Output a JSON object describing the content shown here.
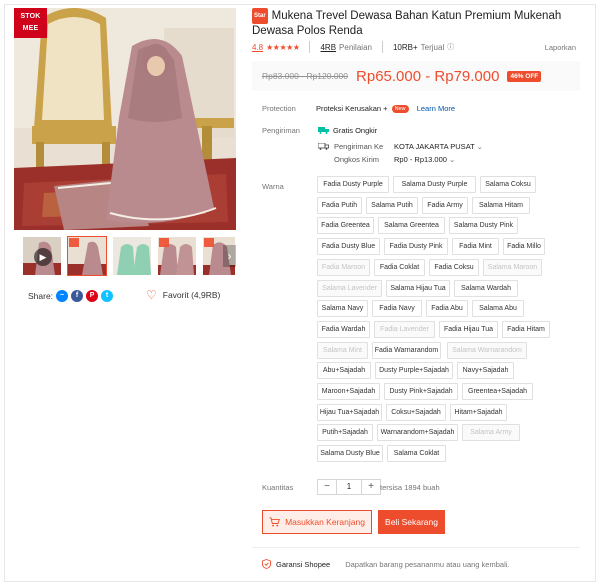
{
  "gallery": {
    "badge_line1": "STOK",
    "badge_line2": "MEE"
  },
  "share": {
    "label": "Share:",
    "icons": [
      "messenger-icon",
      "facebook-icon",
      "pinterest-icon",
      "twitter-icon"
    ]
  },
  "favorite": {
    "label": "Favorit (4,9RB)"
  },
  "product": {
    "star_badge": "Star",
    "title": "Mukena Trevel Dewasa Bahan Katun Premium Mukenah Dewasa Polos Renda",
    "rating": "4.8",
    "stars": "★★★★★",
    "review_count": "4RB",
    "review_label": "Penilaian",
    "sold_count": "10RB+",
    "sold_label": "Terjual",
    "report": "Laporkan",
    "old_price": "Rp83.000 - Rp120.000",
    "price": "Rp65.000 - Rp79.000",
    "discount": "46% OFF"
  },
  "protection": {
    "label": "Protection",
    "value": "Proteksi Kerusakan +",
    "badge": "New",
    "link": "Learn More"
  },
  "shipping": {
    "label": "Pengiriman",
    "free": "Gratis Ongkir",
    "to_label": "Pengiriman Ke",
    "to_value": "KOTA JAKARTA PUSAT",
    "cost_label": "Ongkos Kirim",
    "cost_value": "Rp0 - Rp13.000"
  },
  "variants": {
    "label": "Warna",
    "items": [
      {
        "label": "Fadia Dusty Purple",
        "disabled": false
      },
      {
        "label": "Salama Dusty Purple",
        "disabled": false
      },
      {
        "label": "Salama Coksu",
        "disabled": false
      },
      {
        "label": "Fadia Putih",
        "disabled": false
      },
      {
        "label": "Salama Putih",
        "disabled": false
      },
      {
        "label": "Fadia Army",
        "disabled": false
      },
      {
        "label": "Salama Hitam",
        "disabled": false
      },
      {
        "label": "Fadia Greentea",
        "disabled": false
      },
      {
        "label": "Salama Greentea",
        "disabled": false
      },
      {
        "label": "Salama Dusty Pink",
        "disabled": false
      },
      {
        "label": "Fadia Dusty Blue",
        "disabled": false
      },
      {
        "label": "Fadia Dusty Pink",
        "disabled": false
      },
      {
        "label": "Fadia Mint",
        "disabled": false
      },
      {
        "label": "Fadia Millo",
        "disabled": false
      },
      {
        "label": "Fadia Maroon",
        "disabled": true
      },
      {
        "label": "Fadia Coklat",
        "disabled": false
      },
      {
        "label": "Fadia Coksu",
        "disabled": false
      },
      {
        "label": "Salama Maroon",
        "disabled": true
      },
      {
        "label": "Salama Lavender",
        "disabled": true
      },
      {
        "label": "Salama Hijau Tua",
        "disabled": false
      },
      {
        "label": "Salama Wardah",
        "disabled": false
      },
      {
        "label": "Salama Navy",
        "disabled": false
      },
      {
        "label": "Fadia Navy",
        "disabled": false
      },
      {
        "label": "Fadia Abu",
        "disabled": false
      },
      {
        "label": "Salama Abu",
        "disabled": false
      },
      {
        "label": "Fadia Wardah",
        "disabled": false
      },
      {
        "label": "Fadia Lavender",
        "disabled": true
      },
      {
        "label": "Fadia Hijau Tua",
        "disabled": false
      },
      {
        "label": "Fadia Hitam",
        "disabled": false
      },
      {
        "label": "Salama Mint",
        "disabled": true
      },
      {
        "label": "Fadia Warnarandom",
        "disabled": false
      },
      {
        "label": "Salama Warnarandom",
        "disabled": true
      },
      {
        "label": "Abu+Sajadah",
        "disabled": false
      },
      {
        "label": "Dusty Purple+Sajadah",
        "disabled": false
      },
      {
        "label": "Navy+Sajadah",
        "disabled": false
      },
      {
        "label": "Maroon+Sajadah",
        "disabled": false
      },
      {
        "label": "Dusty Pink+Sajadah",
        "disabled": false
      },
      {
        "label": "Greentea+Sajadah",
        "disabled": false
      },
      {
        "label": "Hijau Tua+Sajadah",
        "disabled": false
      },
      {
        "label": "Coksu+Sajadah",
        "disabled": false
      },
      {
        "label": "Hitam+Sajadah",
        "disabled": false
      },
      {
        "label": "Putih+Sajadah",
        "disabled": false
      },
      {
        "label": "Warnarandom+Sajadah",
        "disabled": false
      },
      {
        "label": "Salama Army",
        "disabled": true
      },
      {
        "label": "Salama Dusty Blue",
        "disabled": false
      },
      {
        "label": "Salama Coklat",
        "disabled": false
      }
    ]
  },
  "quantity": {
    "label": "Kuantitas",
    "minus": "−",
    "value": "1",
    "plus": "+",
    "stock": "tersisa 1894 buah"
  },
  "actions": {
    "cart": "Masukkan Keranjang",
    "buy": "Beli Sekarang"
  },
  "guarantee": {
    "title": "Garansi Shopee",
    "text": "Dapatkan barang pesananmu atau uang kembali."
  },
  "colors": {
    "accent": "#ee4d2d",
    "link": "#0055aa",
    "free_shipping": "#00bfa5"
  }
}
